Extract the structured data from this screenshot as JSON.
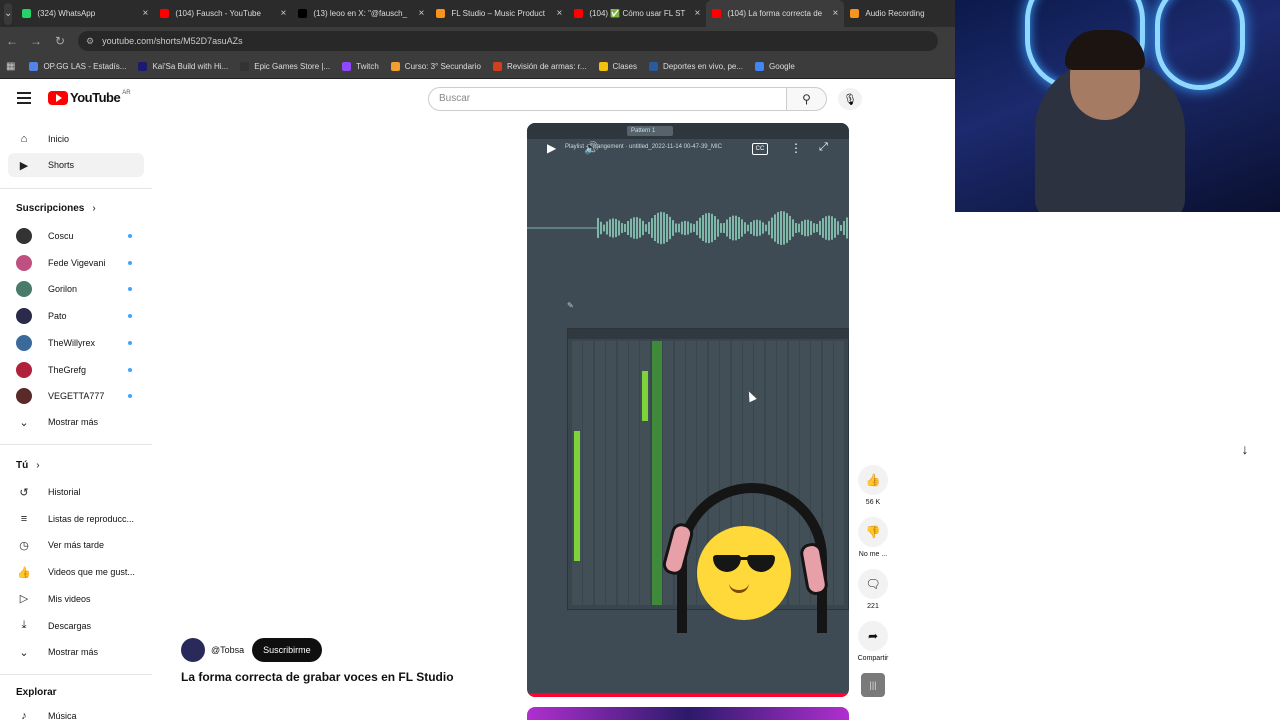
{
  "browser": {
    "tabs": [
      {
        "label": "(324) WhatsApp",
        "color": "#25d366"
      },
      {
        "label": "(104) Fausch - YouTube",
        "color": "#ff0000"
      },
      {
        "label": "(13) leoo en X: \"@fausch_",
        "color": "#000000"
      },
      {
        "label": "FL Studio – Music Product",
        "color": "#f7941d"
      },
      {
        "label": "(104) ✅ Cómo usar FL ST",
        "color": "#ff0000"
      },
      {
        "label": "(104) La forma correcta de",
        "color": "#ff0000"
      },
      {
        "label": "Audio Recording",
        "color": "#f7941d"
      }
    ],
    "active_tab": 5,
    "url": "youtube.com/shorts/M52D7asuAZs",
    "bookmarks": [
      {
        "label": "OP.GG LAS - Estadís...",
        "color": "#5383e8"
      },
      {
        "label": "Kai'Sa Build with Hi...",
        "color": "#1a1a6e"
      },
      {
        "label": "Epic Games Store |...",
        "color": "#333333"
      },
      {
        "label": "Twitch",
        "color": "#9146ff"
      },
      {
        "label": "Curso: 3° Secundario",
        "color": "#f0a030"
      },
      {
        "label": "Revisión de armas: r...",
        "color": "#d04020"
      },
      {
        "label": "Clases",
        "color": "#f4c20d"
      },
      {
        "label": "Deportes en vivo, pe...",
        "color": "#2a5a9a"
      },
      {
        "label": "Google",
        "color": "#4285f4"
      }
    ]
  },
  "youtube": {
    "logo_text": "YouTube",
    "region": "AR",
    "search_placeholder": "Buscar"
  },
  "sidebar": {
    "main": [
      {
        "label": "Inicio",
        "icon": "⌂"
      },
      {
        "label": "Shorts",
        "icon": "▶"
      }
    ],
    "subs_heading": "Suscripciones",
    "subscriptions": [
      {
        "label": "Coscu",
        "color": "#333333"
      },
      {
        "label": "Fede Vigevani",
        "color": "#c05080"
      },
      {
        "label": "Gorilon",
        "color": "#4a7a6a"
      },
      {
        "label": "Pato",
        "color": "#2a2a4a"
      },
      {
        "label": "TheWillyrex",
        "color": "#3a6a9a"
      },
      {
        "label": "TheGrefg",
        "color": "#b0203a"
      },
      {
        "label": "VEGETTA777",
        "color": "#5a2a2a"
      }
    ],
    "show_more": "Mostrar más",
    "you_heading": "Tú",
    "you_items": [
      {
        "label": "Historial",
        "icon": "↺"
      },
      {
        "label": "Listas de reproducc...",
        "icon": "≡"
      },
      {
        "label": "Ver más tarde",
        "icon": "◷"
      },
      {
        "label": "Videos que me gust...",
        "icon": "👍"
      },
      {
        "label": "Mis videos",
        "icon": "▷"
      },
      {
        "label": "Descargas",
        "icon": "⤓"
      }
    ],
    "show_more_2": "Mostrar más",
    "explore_heading": "Explorar",
    "explore_items": [
      {
        "label": "Música",
        "icon": "♪"
      }
    ]
  },
  "short": {
    "channel": "@Tobsa",
    "subscribe": "Suscribirme",
    "title": "La forma correcta de grabar voces en FL Studio",
    "pattern_label": "Pattern 1",
    "playlist_title": "Playlist - Arrangement · untitled_2022-11-14 00-47-39_MIC",
    "cc_label": "CC"
  },
  "actions": {
    "likes": "56 K",
    "dislike": "No me ...",
    "comments": "221",
    "share": "Compartir"
  }
}
